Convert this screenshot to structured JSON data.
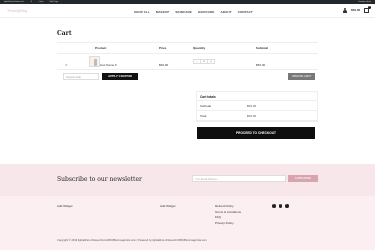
{
  "admin_bar": {
    "items": [
      "lightalkhon-thirteenchr..",
      "8",
      "+ New",
      "Edit Page"
    ],
    "right": "Howdy, admin"
  },
  "header": {
    "logo": "Trendyblog",
    "nav": [
      "SHOP ALL",
      "MAKEUP",
      "SKINCARE",
      "HAIRCARE",
      "ABOUT",
      "CONTACT"
    ],
    "cart_total": "$59.00",
    "cart_count": "1"
  },
  "page": {
    "title": "Cart"
  },
  "cart": {
    "headers": {
      "product": "Product",
      "price": "Price",
      "quantity": "Quantity",
      "subtotal": "Subtotal"
    },
    "items": [
      {
        "remove": "⊗",
        "name": "Product Name 6",
        "price": "$59.00",
        "qty": "1",
        "minus": "-",
        "plus": "+",
        "subtotal": "$59.00"
      }
    ],
    "coupon_placeholder": "Coupon code",
    "apply_label": "APPLY COUPON",
    "update_label": "UPDATE CART"
  },
  "totals": {
    "title": "Cart totals",
    "rows": [
      {
        "label": "Subtotal",
        "value": "$59.00"
      },
      {
        "label": "Total",
        "value": "$59.00"
      }
    ],
    "checkout_label": "PROCEED TO CHECKOUT"
  },
  "newsletter": {
    "title": "Subscribe to our newsletter",
    "placeholder": "Your Email Address...",
    "button": "SUBSCRIBE"
  },
  "footer": {
    "widget1": "Add Widget",
    "widget2": "Add Widget",
    "links": [
      "Refund Policy",
      "Terms & Conditions",
      "FAQ",
      "Privacy Policy"
    ],
    "social": [
      "f",
      "t",
      "i"
    ],
    "copyright": "Copyright © 2019 lightalkhon-thirteenchrom38015flerxmagicnite.com | Powered by lightalkhon-thirteenchr38015flerxmagicnite.com"
  }
}
